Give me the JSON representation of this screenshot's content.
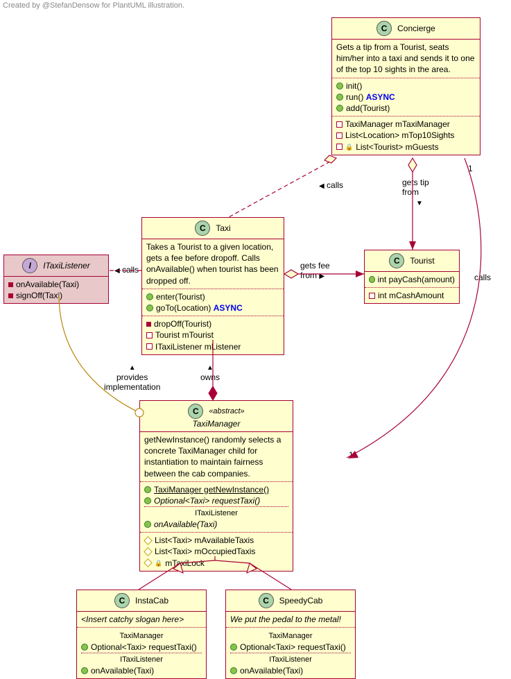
{
  "caption": "Created by @StefanDensow for PlantUML illustration.",
  "classes": {
    "concierge": {
      "name": "Concierge",
      "desc": "Gets a tip from a Tourist, seats him/her into a taxi and sends it to one of the top 10 sights in the area.",
      "methods": {
        "init": "init()",
        "run": "run()",
        "run_async": "ASYNC",
        "add": "add(Tourist)"
      },
      "fields": {
        "tm": "TaxiManager mTaxiManager",
        "top10": "List<Location> mTop10Sights",
        "guests": "List<Tourist> mGuests"
      }
    },
    "taxi": {
      "name": "Taxi",
      "desc": "Takes a Tourist to a given location, gets a fee before dropoff. Calls onAvailable() when tourist has been dropped off.",
      "methods": {
        "enter": "enter(Tourist)",
        "goto": "goTo(Location)",
        "goto_async": "ASYNC"
      },
      "priv": {
        "drop": "dropOff(Tourist)",
        "tourist": "Tourist mTourist",
        "listener": "ITaxiListener mListener"
      }
    },
    "tourist": {
      "name": "Tourist",
      "method": "int payCash(amount)",
      "field": "int mCashAmount"
    },
    "itaxilistener": {
      "name": "ITaxiListener",
      "onAvail": "onAvailable(Taxi)",
      "signOff": "signOff(Taxi)"
    },
    "taximanager": {
      "stereo": "«abstract»",
      "name": "TaxiManager",
      "desc": "getNewInstance() randomly selects a concrete TaxiManager child for instantiation to maintain fairness between the cab companies.",
      "m1": "TaxiManager getNewInstance()",
      "m2": "Optional<Taxi> requestTaxi()",
      "itl": "ITaxiListener",
      "onAvail": "onAvailable(Taxi)",
      "f1": "List<Taxi> mAvailableTaxis",
      "f2": "List<Taxi> mOccupiedTaxis",
      "f3": "mTaxiLock"
    },
    "instacab": {
      "name": "InstaCab",
      "slogan": "<Insert catchy slogan here>",
      "tm": "TaxiManager",
      "req": "Optional<Taxi> requestTaxi()",
      "itl": "ITaxiListener",
      "onAvail": "onAvailable(Taxi)"
    },
    "speedycab": {
      "name": "SpeedyCab",
      "slogan": "We put the pedal to the metal!",
      "tm": "TaxiManager",
      "req": "Optional<Taxi> requestTaxi()",
      "itl": "ITaxiListener",
      "onAvail": "onAvailable(Taxi)"
    }
  },
  "labels": {
    "calls1": "calls",
    "gets_tip": "gets tip\nfrom",
    "gets_fee": "gets fee\nfrom",
    "calls2": "calls",
    "calls3": "calls",
    "owns": "owns",
    "provides": "provides\nimplementation",
    "one_a": "1",
    "one_b": "1"
  }
}
